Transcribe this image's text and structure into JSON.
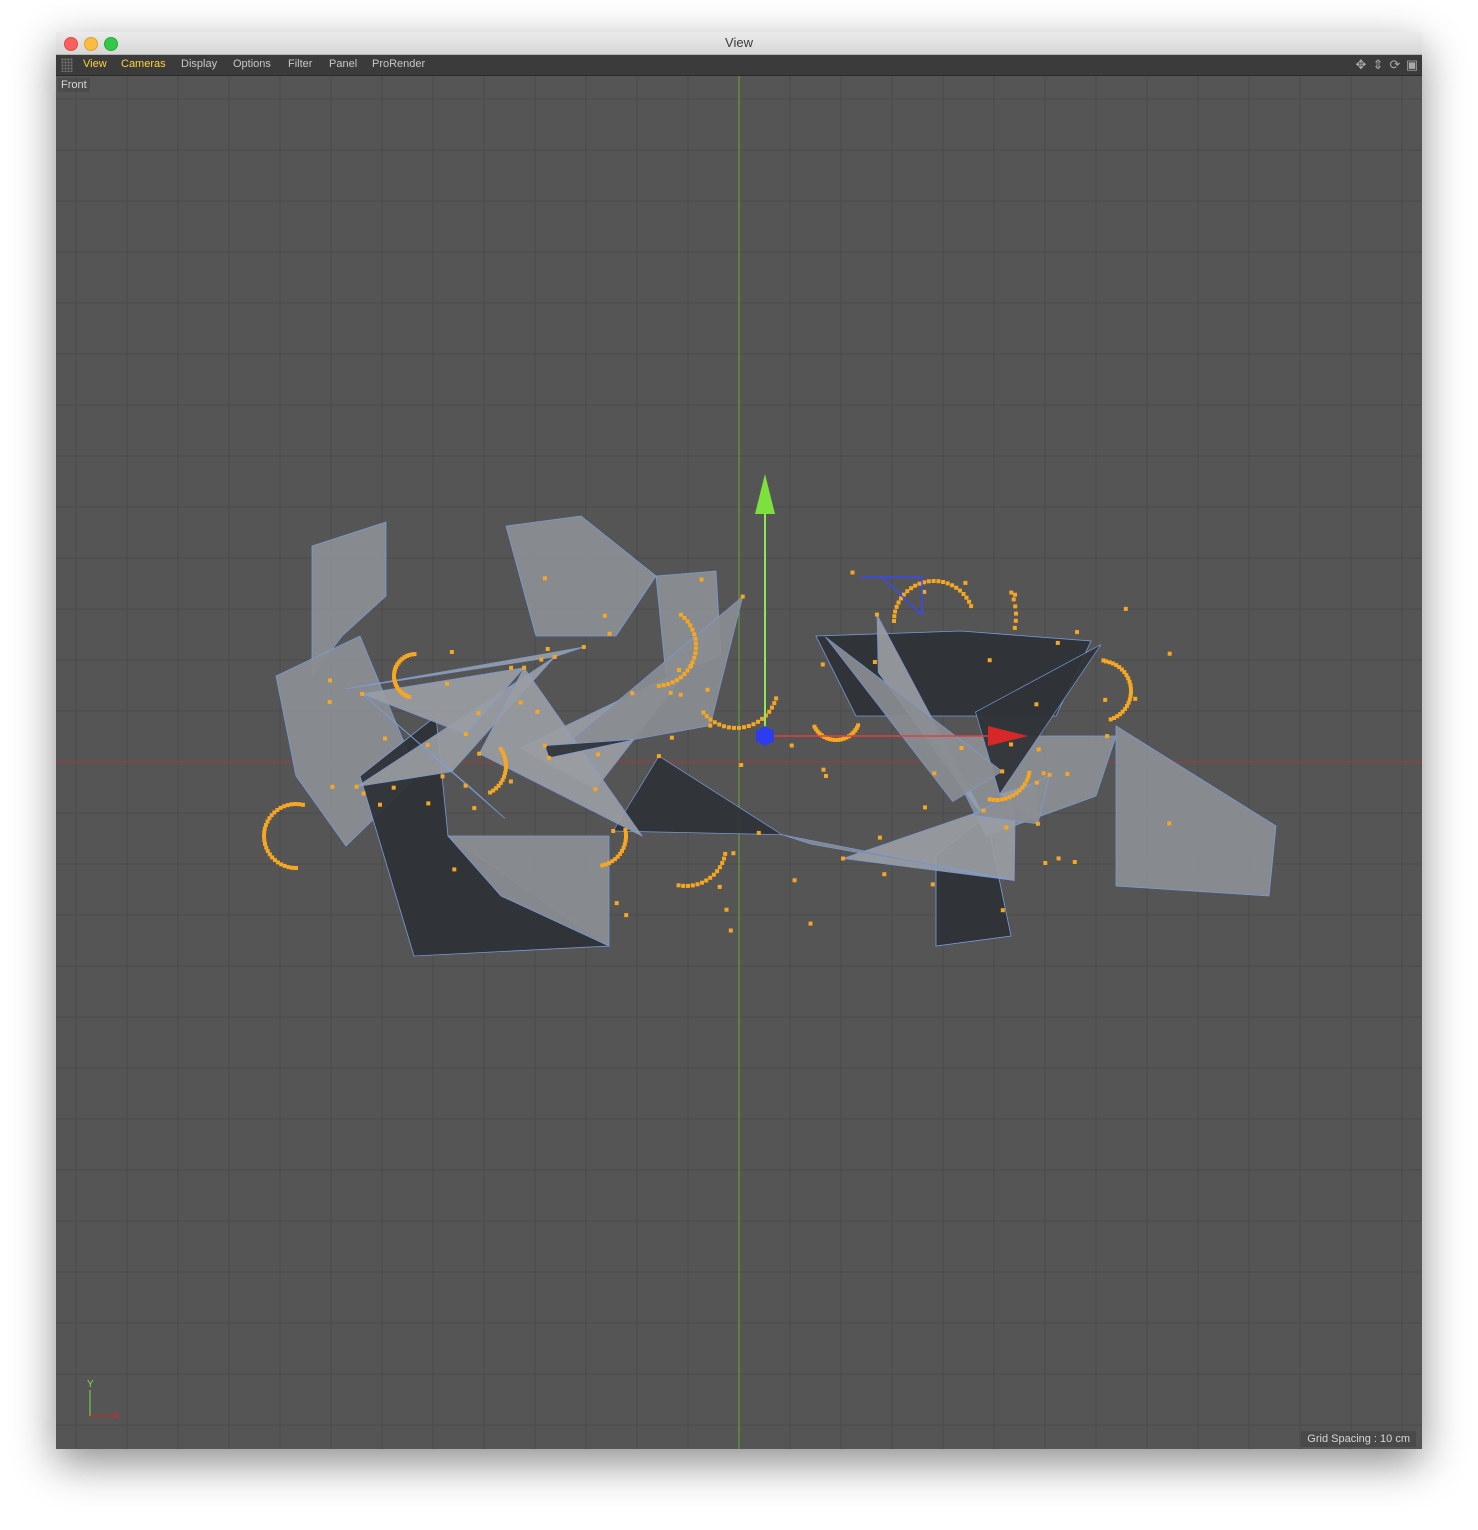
{
  "window": {
    "title": "View"
  },
  "menubar": {
    "items": [
      "View",
      "Cameras",
      "Display",
      "Options",
      "Filter",
      "Panel",
      "ProRender"
    ],
    "active_items": [
      "View",
      "Cameras"
    ],
    "tool_icons": [
      "move-view-icon",
      "zoom-view-icon",
      "rotate-view-icon",
      "toggle-layout-icon"
    ]
  },
  "viewport": {
    "camera": "Front",
    "grid_spacing": "Grid Spacing : 10 cm",
    "axis_gizmo": {
      "y_label": "Y",
      "x_label": "X"
    }
  },
  "colors": {
    "viewport_bg": "#555555",
    "grid": "#4a4a4a",
    "active_menu": "#ffd23a",
    "mesh_face": "#8a8d92",
    "mesh_shadow": "#2f3236",
    "edges": "#7aa0e0",
    "points": "#f5a623",
    "y_axis": "#7ee03c",
    "x_axis": "#d62828",
    "z_axis": "#2e3cf0"
  }
}
